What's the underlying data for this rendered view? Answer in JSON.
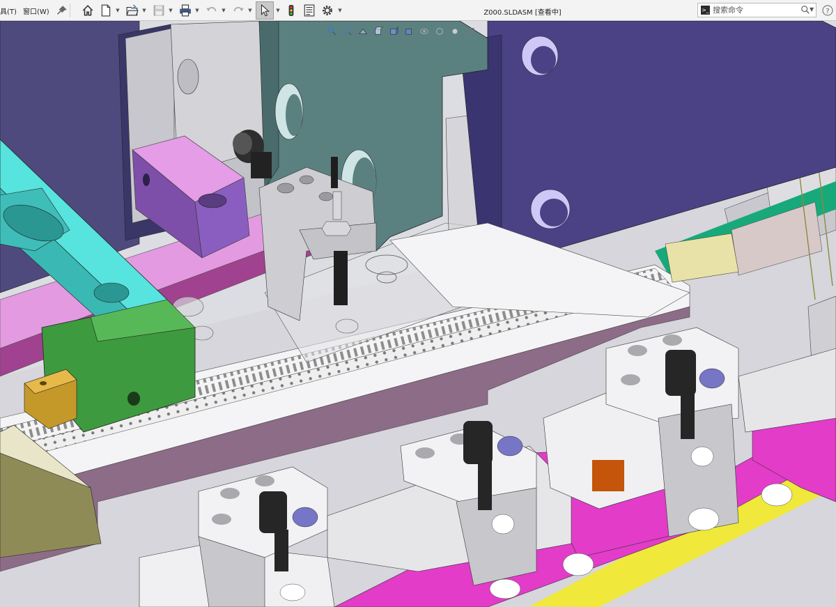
{
  "menu": {
    "tools_label": "具(T)",
    "window_label": "窗口(W)"
  },
  "toolbar": {
    "icons": [
      "pin-icon",
      "home-icon",
      "new-document-icon",
      "open-folder-icon",
      "save-icon",
      "print-icon",
      "undo-icon",
      "redo-icon",
      "select-pointer-icon",
      "traffic-light-icon",
      "file-properties-icon",
      "options-gear-icon"
    ]
  },
  "document": {
    "title": "Z000.SLDASM [查看中]"
  },
  "search": {
    "placeholder": "搜索命令",
    "value": ""
  },
  "heads_up_icons": [
    "zoom-to-fit-icon",
    "zoom-area-icon",
    "previous-view-icon",
    "section-view-icon",
    "view-orientation-icon",
    "display-style-icon",
    "hide-show-items-icon",
    "edit-appearance-icon",
    "apply-scene-icon",
    "view-settings-icon"
  ],
  "colors": {
    "toolbar_bg": "#f3f3f3",
    "plate_blue": "#4a4285",
    "teal_guide": "#4fd0cc",
    "green_block": "#3e9a3e",
    "magenta_part": "#e23cc8",
    "grey_part": "#c8c8cc",
    "mauve_base": "#8c6c87",
    "slate_bracket": "#5b8080",
    "yellow_strip": "#f0e83a",
    "orange_pad": "#c4550a"
  }
}
